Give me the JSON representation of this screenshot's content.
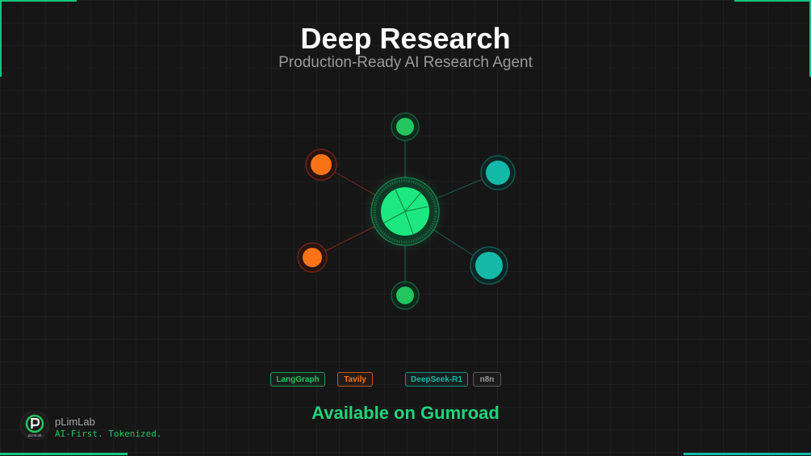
{
  "header": {
    "title": "Deep Research",
    "subtitle": "Production-Ready AI Research Agent"
  },
  "tags": [
    {
      "label": "LangGraph",
      "color": "#22c55e"
    },
    {
      "label": "Tavily",
      "color": "#f97316"
    },
    {
      "label": "DeepSeek-R1",
      "color": "#14b8a6"
    },
    {
      "label": "n8n",
      "color": "#9a9a9a"
    }
  ],
  "cta": {
    "text": "Available on Gumroad",
    "color": "#22d37a"
  },
  "brand": {
    "name": "pLimLab",
    "tagline": "AI-First. Tokenized.",
    "logo_text": "pLimLab",
    "logo_icon": "p-logo-icon"
  },
  "colors": {
    "hub": "#1de87f",
    "green_node": "#22c55e",
    "orange_node": "#f97316",
    "teal_node": "#14b8a6",
    "accent": "#16c47f"
  }
}
